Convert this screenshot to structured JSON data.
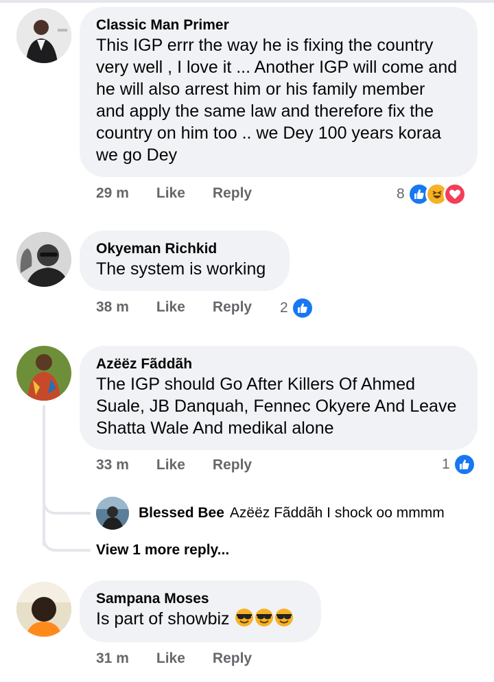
{
  "comments": [
    {
      "author": "Classic Man Primer",
      "text_lines": [
        "This IGP errr the way he is fixing the country",
        "very well ,  I love it ... Another IGP will come and",
        "he will also arrest him or his family member",
        "and apply the same law and therefore fix the",
        "country on him too .. we Dey 100 years koraa",
        "we go Dey"
      ],
      "time": "29 m",
      "like_label": "Like",
      "reply_label": "Reply",
      "reaction_count": "8",
      "reactions": [
        "like-icon",
        "haha-icon",
        "love-icon"
      ]
    },
    {
      "author": "Okyeman Richkid",
      "text_lines": [
        "The system is working"
      ],
      "time": "38 m",
      "like_label": "Like",
      "reply_label": "Reply",
      "reaction_count": "2",
      "reactions": [
        "like-icon"
      ]
    },
    {
      "author": "Azëëz Fãddãh",
      "text_lines": [
        "The IGP should Go After Killers Of Ahmed",
        "Suale, JB Danquah, Fennec Okyere And Leave",
        "Shatta Wale And medikal alone"
      ],
      "time": "33 m",
      "like_label": "Like",
      "reply_label": "Reply",
      "reaction_count": "1",
      "reactions": [
        "like-icon"
      ],
      "reply": {
        "author": "Blessed Bee",
        "text": "Azëëz Fãddãh I shock oo mmmm"
      },
      "more_replies": "View 1 more reply..."
    },
    {
      "author": "Sampana Moses",
      "text": "Is part of showbiz",
      "emojis": [
        "sunglasses-emoji",
        "sunglasses-emoji",
        "sunglasses-emoji"
      ],
      "time": "31 m",
      "like_label": "Like",
      "reply_label": "Reply"
    }
  ],
  "colors": {
    "bubble": "#f0f2f5",
    "meta_text": "#65676b",
    "like_blue": "#1877f2",
    "haha_yellow": "#f7b125",
    "love_red": "#f33e58"
  }
}
